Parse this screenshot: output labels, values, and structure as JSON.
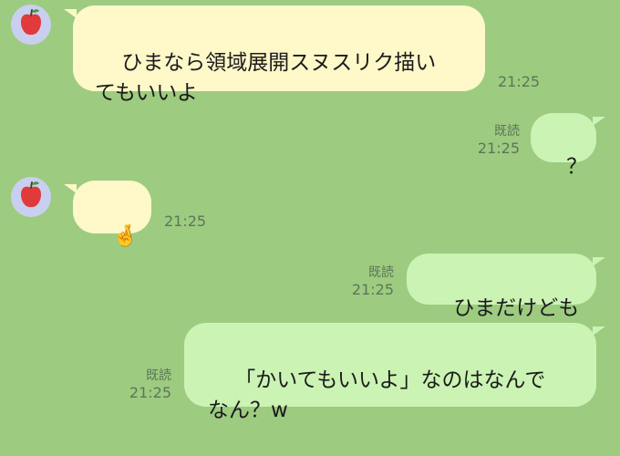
{
  "messages": [
    {
      "direction": "incoming",
      "text": "ひまなら領域展開スヌスリク描い\nてもいいよ",
      "time": "21:25"
    },
    {
      "direction": "outgoing",
      "text": "？",
      "read": "既読",
      "time": "21:25"
    },
    {
      "direction": "incoming",
      "text": "🤞",
      "time": "21:25"
    },
    {
      "direction": "outgoing",
      "text": "ひまだけども",
      "read": "既読",
      "time": "21:25"
    },
    {
      "direction": "outgoing",
      "text": "「かいてもいいよ」なのはなんで\nなん？w",
      "read": "既読",
      "time": "21:25"
    }
  ],
  "avatar_icon": "apple-icon",
  "colors": {
    "background": "#9dcb80",
    "incoming_bubble": "#fff8c8",
    "outgoing_bubble": "#cbf3b4",
    "avatar_bg": "#c9d0ef"
  }
}
